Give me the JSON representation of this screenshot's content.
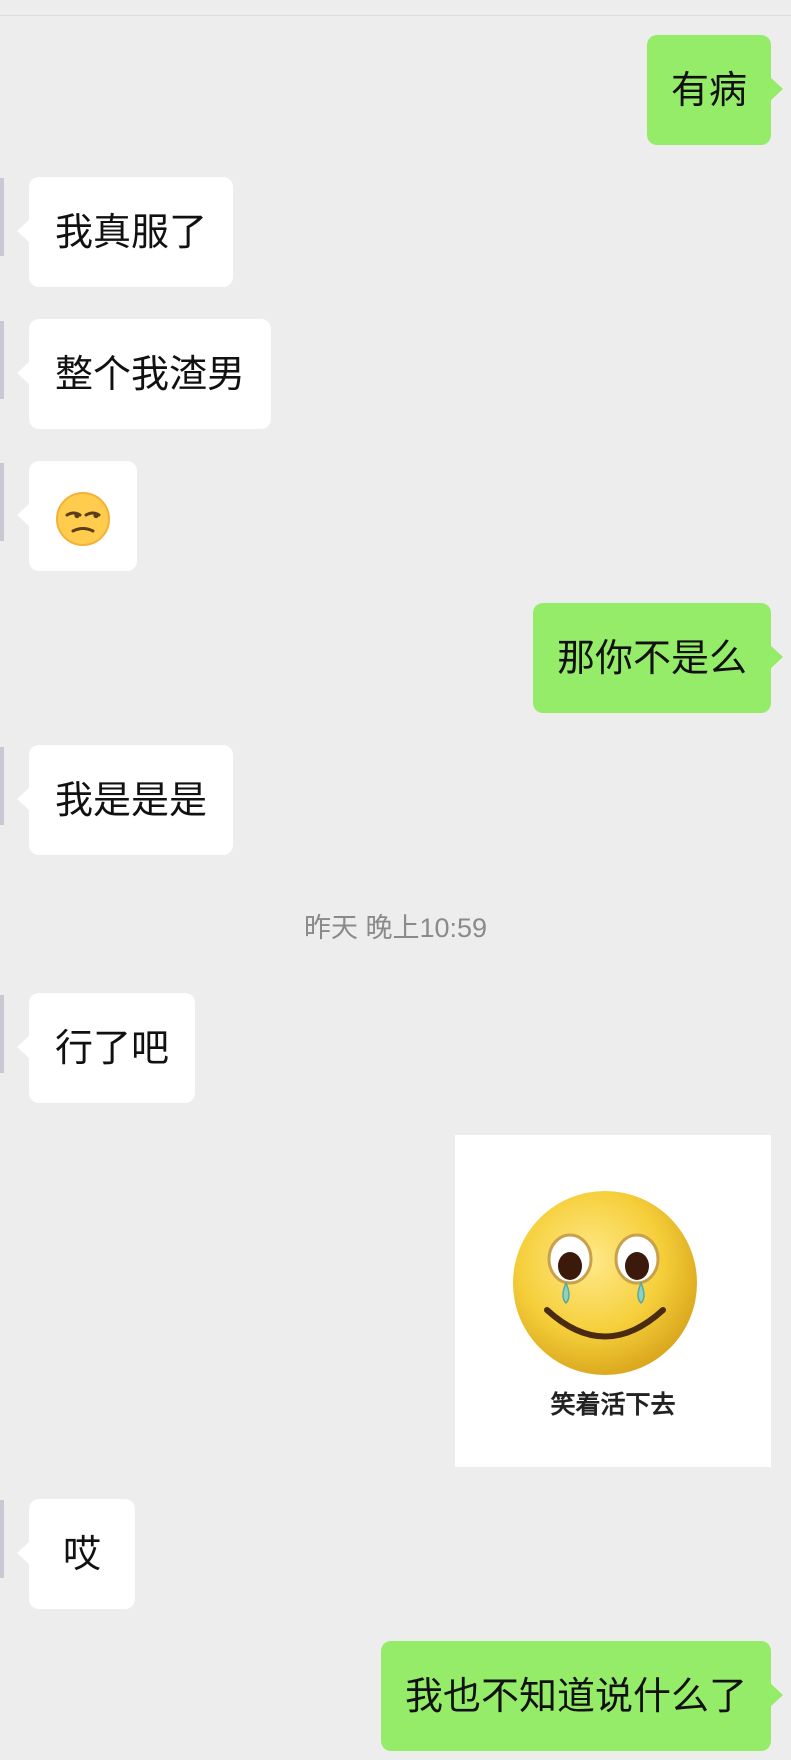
{
  "messages": [
    {
      "side": "right",
      "text": "有病"
    },
    {
      "side": "left",
      "text": "我真服了"
    },
    {
      "side": "left",
      "text": "整个我渣男"
    },
    {
      "side": "left",
      "emoji": "unamused-face-emoji"
    },
    {
      "side": "right",
      "text": "那你不是么"
    },
    {
      "side": "left",
      "text": "我是是是"
    },
    {
      "side": "left",
      "text": "行了吧"
    },
    {
      "side": "right",
      "sticker": "crying-smiley-sticker",
      "caption": "笑着活下去"
    },
    {
      "side": "left",
      "text": "哎"
    },
    {
      "side": "right",
      "text": "我也不知道说什么了"
    }
  ],
  "timestamp": "昨天 晚上10:59",
  "colors": {
    "background": "#ededed",
    "sent_bubble": "#95ec69",
    "received_bubble": "#ffffff",
    "timestamp": "#8a8a8a"
  }
}
